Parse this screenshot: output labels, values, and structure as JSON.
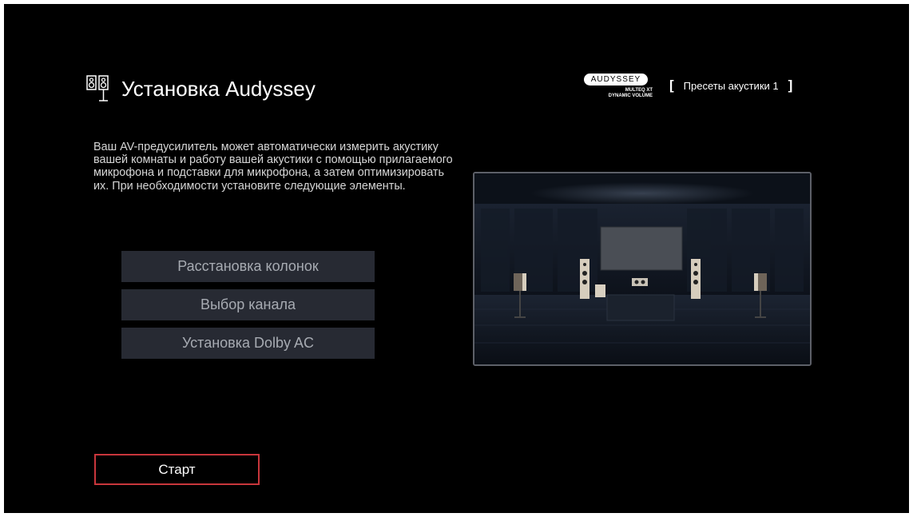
{
  "header": {
    "icon": "speaker-pair-icon",
    "title": "Установка Audyssey",
    "brand": {
      "logo_text": "AUDYSSEY",
      "line1": "MULTEQ XT",
      "line2": "DYNAMIC VOLUME"
    },
    "preset": {
      "open_bracket": "[",
      "label": "Пресеты акустики 1",
      "close_bracket": "]"
    }
  },
  "description": "Ваш AV-предусилитель может автоматически измерить акустику вашей комнаты и работу вашей акустики с помощью прилагаемого микрофона и подставки для микрофона, а затем оптимизировать их. При необходимости установите следующие элементы.",
  "menu": {
    "items": [
      {
        "label": "Расстановка колонок"
      },
      {
        "label": "Выбор канала"
      },
      {
        "label": "Установка Dolby AC"
      }
    ]
  },
  "start_button": {
    "label": "Старт"
  },
  "preview": {
    "icon": "home-theater-room-illustration"
  },
  "colors": {
    "background": "#000000",
    "button_bg": "#272a33",
    "button_text": "#a7abb2",
    "accent_border": "#c8363c",
    "text": "#ffffff"
  }
}
